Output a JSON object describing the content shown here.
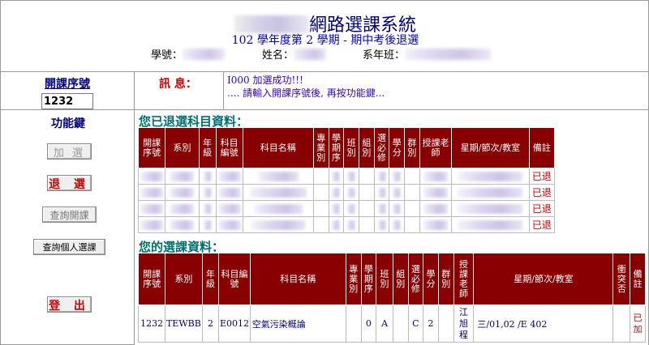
{
  "header": {
    "system_title": "網路選課系統",
    "term_line": "102 學年度第 2 學期 - 期中考後退選",
    "student_id_label": "學號：",
    "name_label": "姓名：",
    "class_label": "系年班："
  },
  "course_entry": {
    "label": "開課序號",
    "value": "1232"
  },
  "message": {
    "label": "訊 息：",
    "line1": "I000 加選成功!!!",
    "line2": ".... 請輸入開課序號後, 再按功能鍵..."
  },
  "functions": {
    "label": "功能鍵",
    "add": "加 選",
    "drop": "退 選",
    "query_offered": "查詢開課",
    "query_personal": "查詢個人選課",
    "logout": "登 出"
  },
  "withdrawn_section": {
    "title": "您已退選科目資料：",
    "columns": [
      "開課序號",
      "系別",
      "年級",
      "科目編號",
      "科目名稱",
      "專業別",
      "學期序",
      "班別",
      "組別",
      "選必修",
      "學分",
      "群別",
      "授課老師",
      "星期/節次/教室",
      "備註"
    ],
    "rows": [
      {
        "remark": "已退"
      },
      {
        "remark": "已退"
      },
      {
        "remark": "已退"
      },
      {
        "remark": "已退"
      }
    ]
  },
  "enrolled_section": {
    "title": "您的選課資料：",
    "columns": [
      "開課序號",
      "系別",
      "年級",
      "科目編號",
      "科目名稱",
      "專業別",
      "學期序",
      "班別",
      "組別",
      "選必修",
      "學分",
      "群別",
      "授課老師",
      "星期/節次/教室",
      "衝突否",
      "備註"
    ],
    "rows": [
      {
        "course_no": "1232",
        "dept": "TEWBB",
        "grade": "2",
        "subject_code": "E0012",
        "subject_name": "空氣污染概論",
        "specialty": "",
        "semester_seq": "0",
        "class": "A",
        "group": "",
        "elective": "C",
        "credits": "2",
        "cluster": "",
        "teacher": "江旭程",
        "schedule": "三/01,02 /E 402",
        "conflict": "",
        "remark": "已加"
      }
    ]
  }
}
